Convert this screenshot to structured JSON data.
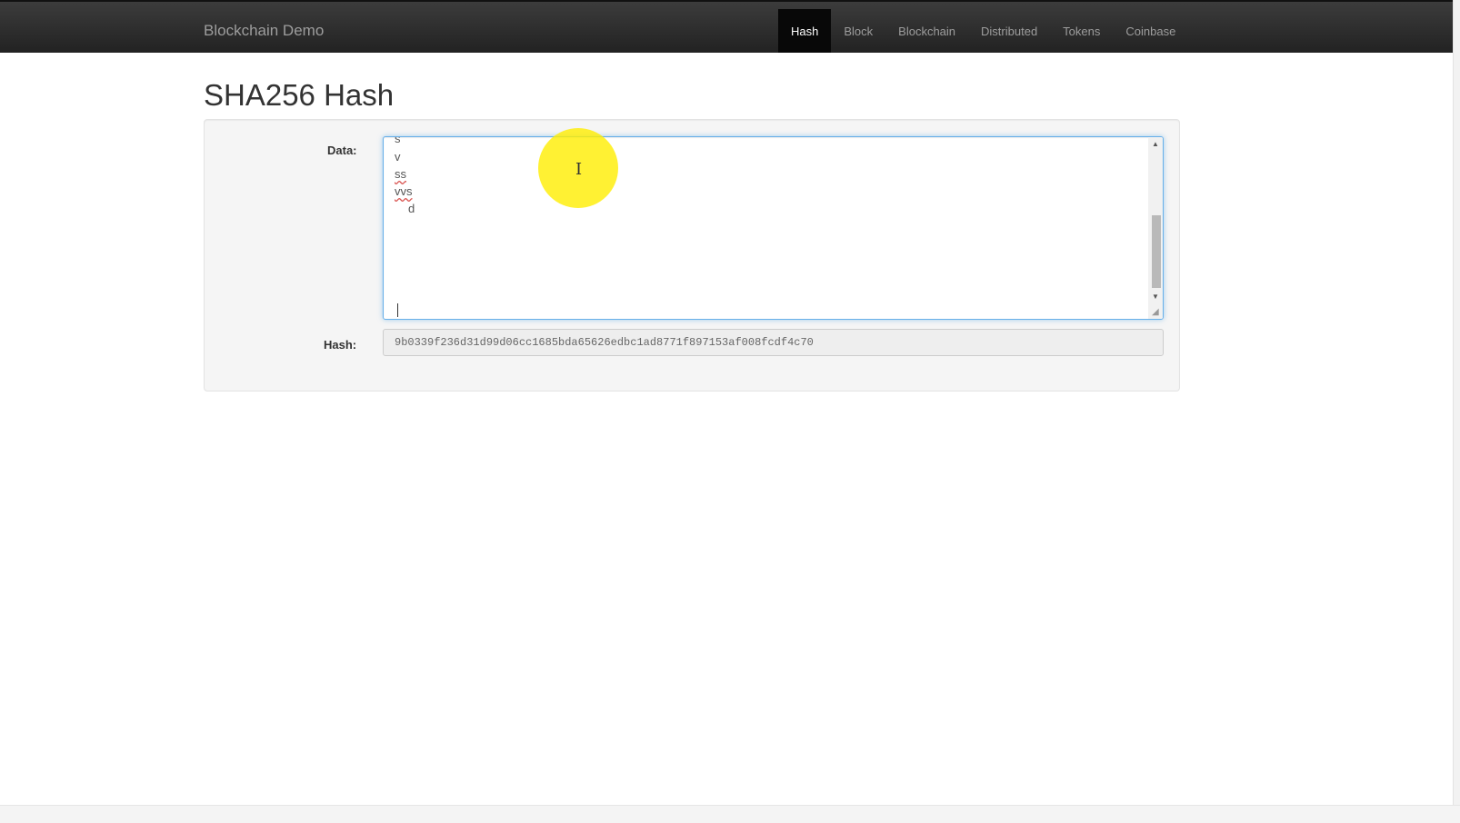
{
  "app": {
    "brand": "Blockchain Demo"
  },
  "nav": {
    "items": [
      {
        "label": "Hash",
        "active": true
      },
      {
        "label": "Block",
        "active": false
      },
      {
        "label": "Blockchain",
        "active": false
      },
      {
        "label": "Distributed",
        "active": false
      },
      {
        "label": "Tokens",
        "active": false
      },
      {
        "label": "Coinbase",
        "active": false
      }
    ]
  },
  "page": {
    "title": "SHA256 Hash"
  },
  "form": {
    "data_label": "Data:",
    "data_lines": [
      "s",
      "v",
      "ss",
      "vvs",
      "   d"
    ],
    "hash_label": "Hash:",
    "hash_value": "9b0339f236d31d99d06cc1685bda65626edbc1ad8771f897153af008fcdf4c70"
  },
  "icons": {
    "scroll_up": "scroll-up-arrow-icon",
    "scroll_down": "scroll-down-arrow-icon",
    "cursor": "text-cursor-icon"
  },
  "colors": {
    "navbar": "#222222",
    "active_tab": "#080808",
    "focus_border": "#66afe9",
    "cursor_highlight": "#ffee00"
  }
}
